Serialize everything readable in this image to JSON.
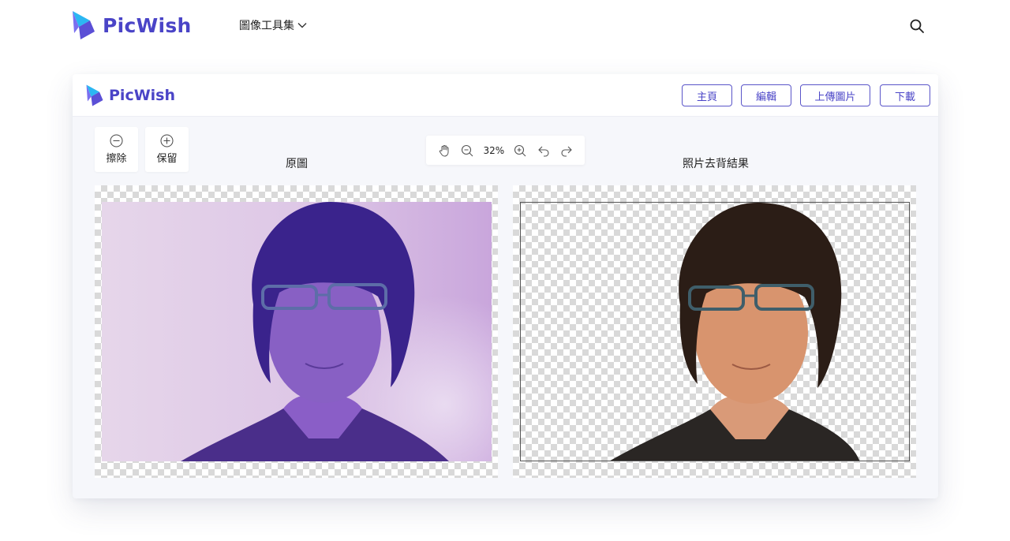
{
  "site": {
    "brand": "PicWish",
    "nav_tools_label": "圖像工具集",
    "icons": [
      "picwish-logo-icon",
      "chevron-down-icon",
      "search-icon"
    ]
  },
  "editor": {
    "brand": "PicWish",
    "buttons": {
      "home": "主頁",
      "edit": "編輯",
      "upload": "上傳圖片",
      "download": "下載"
    },
    "tools": {
      "erase": "擦除",
      "keep": "保留"
    },
    "zoom": {
      "value": "32%",
      "icons": [
        "hand-icon",
        "zoom-out-icon",
        "zoom-in-icon",
        "undo-icon",
        "redo-icon"
      ]
    },
    "panes": {
      "original_title": "原圖",
      "result_title": "照片去背結果"
    }
  },
  "colors": {
    "brand": "#4a44c7",
    "brand_accent": "#2bb7f2",
    "card_bg": "#f6f7fb"
  }
}
